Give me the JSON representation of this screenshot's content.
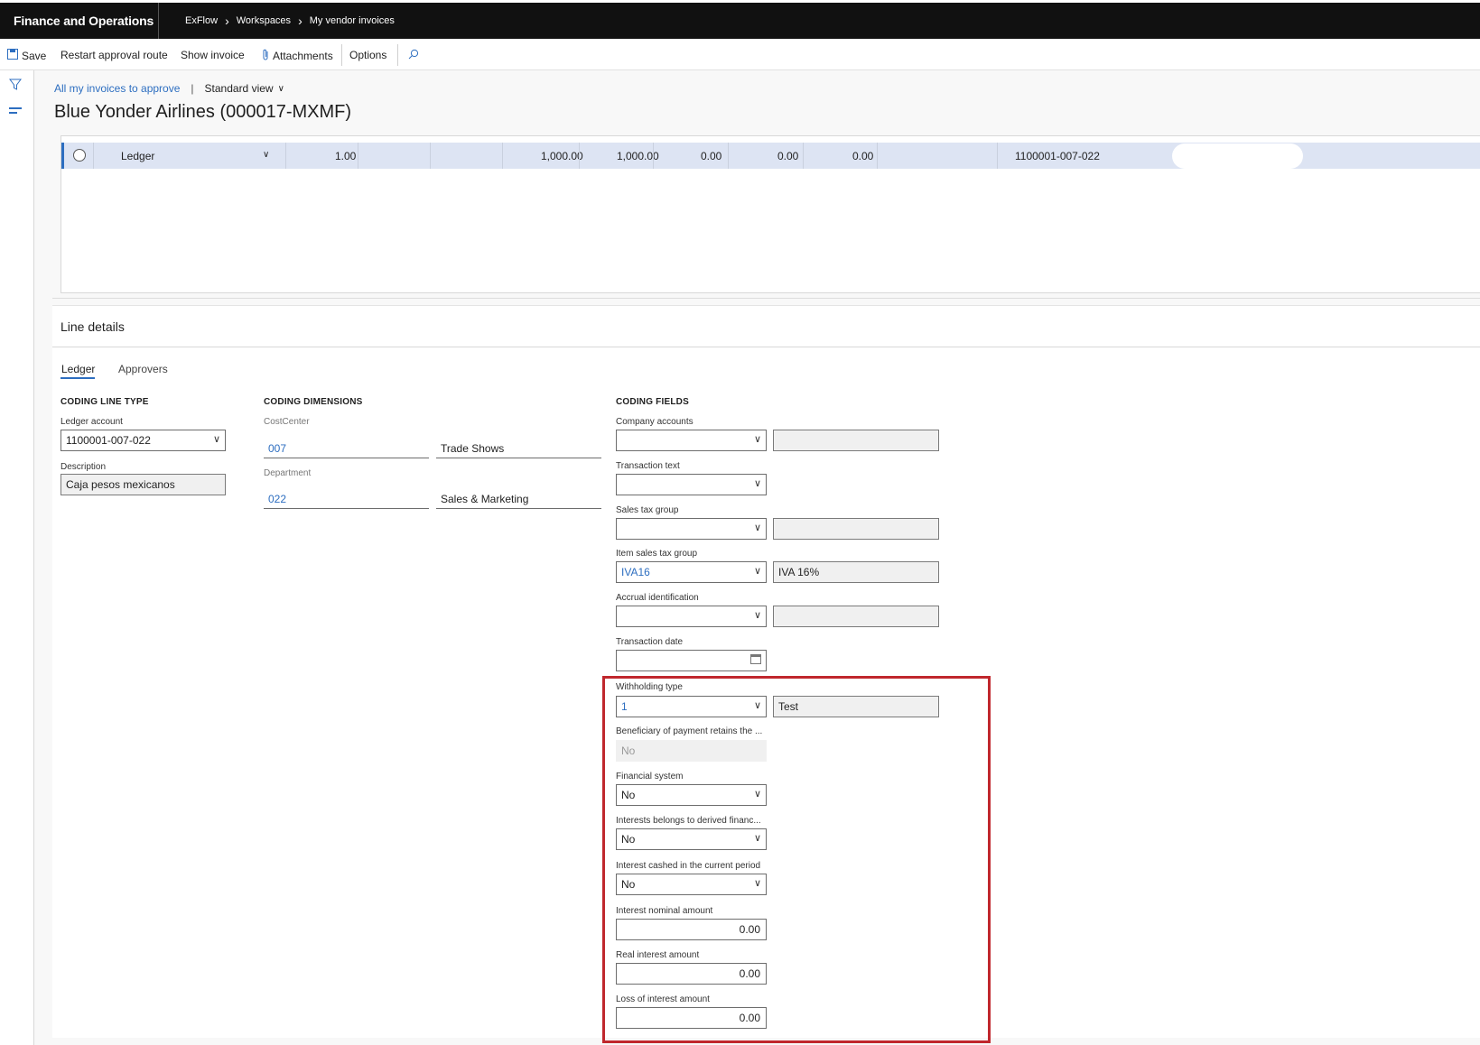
{
  "topbar": {
    "app_name": "Finance and Operations",
    "breadcrumbs": [
      "ExFlow",
      "Workspaces",
      "My vendor invoices"
    ]
  },
  "actions": {
    "save": "Save",
    "restart": "Restart approval route",
    "show_invoice": "Show invoice",
    "attachments": "Attachments",
    "options": "Options"
  },
  "view": {
    "filter_link": "All my invoices to approve",
    "separator": "|",
    "view_name": "Standard view"
  },
  "page_title": "Blue Yonder Airlines (000017-MXMF)",
  "grid": {
    "row": {
      "type": "Ledger",
      "qty": "1.00",
      "amt1": "1,000.00",
      "amt2": "1,000.00",
      "v1": "0.00",
      "v2": "0.00",
      "v3": "0.00",
      "account": "1100001-007-022"
    }
  },
  "line_details": {
    "title": "Line details",
    "tabs": [
      "Ledger",
      "Approvers"
    ]
  },
  "coding_line_type": {
    "heading": "CODING LINE TYPE",
    "ledger_account_label": "Ledger account",
    "ledger_account": "1100001-007-022",
    "description_label": "Description",
    "description": "Caja pesos mexicanos"
  },
  "coding_dimensions": {
    "heading": "CODING DIMENSIONS",
    "cost_center_label": "CostCenter",
    "cost_center": "007",
    "cost_center_name": "Trade Shows",
    "department_label": "Department",
    "department": "022",
    "department_name": "Sales & Marketing"
  },
  "coding_fields": {
    "heading": "CODING FIELDS",
    "company_accounts_label": "Company accounts",
    "transaction_text_label": "Transaction text",
    "sales_tax_group_label": "Sales tax group",
    "item_sales_tax_group_label": "Item sales tax group",
    "item_sales_tax_group": "IVA16",
    "item_sales_tax_group_name": "IVA 16%",
    "accrual_label": "Accrual identification",
    "transaction_date_label": "Transaction date",
    "withholding_type_label": "Withholding type",
    "withholding_type": "1",
    "withholding_type_name": "Test",
    "beneficiary_label": "Beneficiary of payment retains the ...",
    "beneficiary": "No",
    "financial_system_label": "Financial system",
    "financial_system": "No",
    "interests_derived_label": "Interests belongs to derived financ...",
    "interests_derived": "No",
    "interest_cashed_label": "Interest cashed in the current period",
    "interest_cashed": "No",
    "interest_nominal_label": "Interest nominal amount",
    "interest_nominal": "0.00",
    "real_interest_label": "Real interest amount",
    "real_interest": "0.00",
    "loss_interest_label": "Loss of interest amount",
    "loss_interest": "0.00"
  },
  "highlight_color": "#c0272d",
  "accent_color": "#2d6ec0"
}
